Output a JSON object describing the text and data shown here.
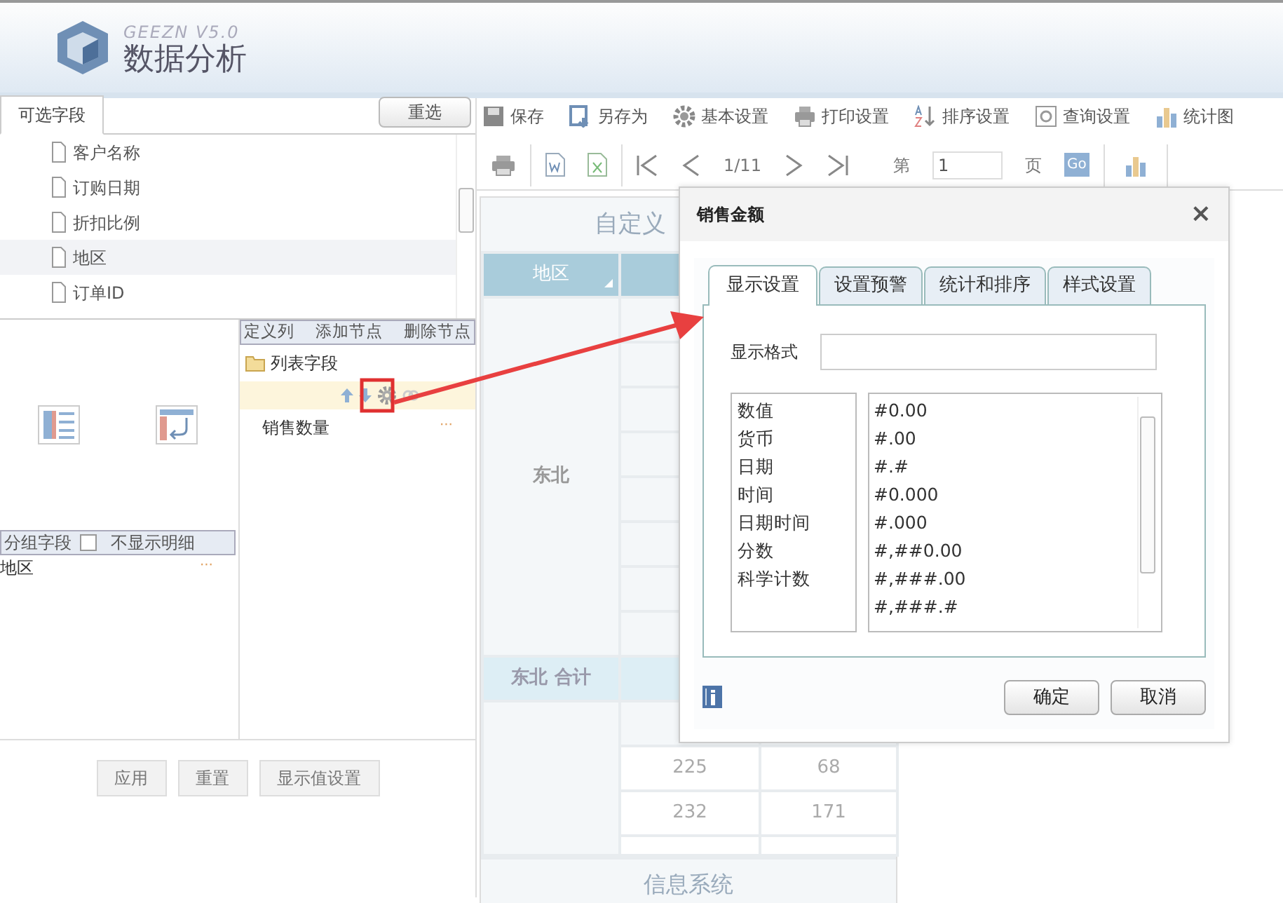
{
  "header": {
    "version": "GEEZN  V5.0",
    "title": "数据分析"
  },
  "field_panel": {
    "tab": "可选字段",
    "reset_button": "重选",
    "fields": [
      {
        "label": "客户名称",
        "selected": false
      },
      {
        "label": "订购日期",
        "selected": false
      },
      {
        "label": "折扣比例",
        "selected": false
      },
      {
        "label": "地区",
        "selected": true
      },
      {
        "label": "订单ID",
        "selected": false
      }
    ]
  },
  "group_panel": {
    "label": "分组字段",
    "hide_detail": {
      "label": "不显示明细",
      "checked": false
    },
    "items": [
      {
        "label": "地区",
        "more": "···"
      }
    ]
  },
  "column_panel": {
    "actions": [
      "定义列",
      "添加节点",
      "删除节点"
    ],
    "folder": "列表字段",
    "items": [
      {
        "label": "销售数量",
        "more": "···"
      }
    ]
  },
  "bottom_buttons": [
    "应用",
    "重置",
    "显示值设置"
  ],
  "toolbar": [
    "保存",
    "另存为",
    "基本设置",
    "打印设置",
    "排序设置",
    "查询设置",
    "统计图"
  ],
  "pager": {
    "page_info": "1/11",
    "page_prefix": "第",
    "page_value": "1",
    "page_suffix": "页",
    "go": "Go"
  },
  "report": {
    "title": "自定义",
    "columns": [
      "地区"
    ],
    "groups": [
      {
        "region": "东北",
        "subtotal": "东北 合计"
      }
    ],
    "rows_after": [
      [
        "225",
        "68"
      ],
      [
        "232",
        "171"
      ]
    ],
    "footer": "信息系统"
  },
  "dialog": {
    "title": "销售金额",
    "close": "×",
    "tabs": [
      {
        "label": "显示设置",
        "selected": true
      },
      {
        "label": "设置预警",
        "selected": false
      },
      {
        "label": "统计和排序",
        "selected": false
      },
      {
        "label": "样式设置",
        "selected": false
      }
    ],
    "format_label": "显示格式",
    "types": [
      "数值",
      "货币",
      "日期",
      "时间",
      "日期时间",
      "分数",
      "科学计数"
    ],
    "formats": [
      "#0.00",
      "#.00",
      "#.#",
      "#0.000",
      "#.000",
      "#,##0.00",
      "#,###.00",
      "#,###.#"
    ],
    "buttons": [
      "确定",
      "取消"
    ]
  }
}
